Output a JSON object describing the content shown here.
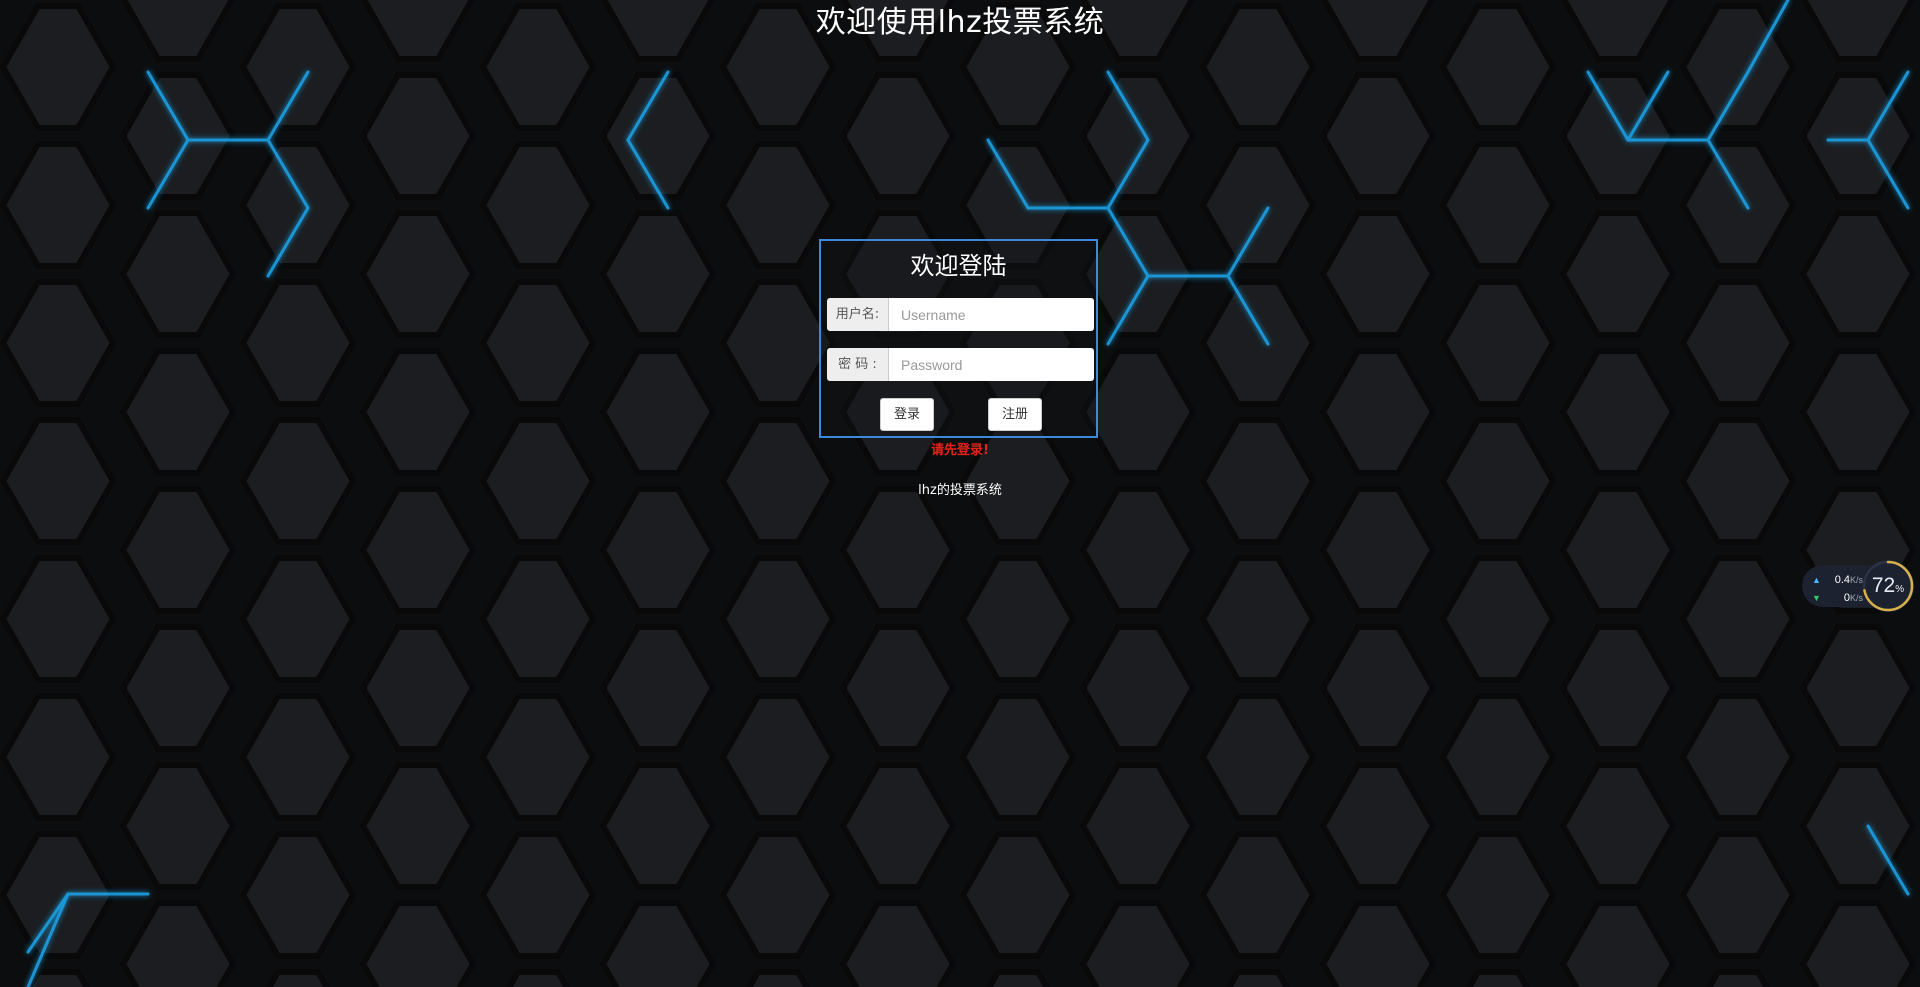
{
  "page": {
    "title": "欢迎使用lhz投票系统"
  },
  "login_form": {
    "heading": "欢迎登陆",
    "username_label": "用户名:",
    "username_placeholder": "Username",
    "password_label": "密 码 :",
    "password_placeholder": "Password",
    "login_button": "登录",
    "register_button": "注册"
  },
  "alert": {
    "message": "请先登录!",
    "color": "#e8221b"
  },
  "footer": {
    "text": "lhz的投票系统"
  },
  "network_widget": {
    "upload_value": "0.4",
    "upload_unit": "K/s",
    "download_value": "0",
    "download_unit": "K/s",
    "usage_value": "72",
    "usage_unit": "%",
    "usage_fraction": 0.72
  },
  "colors": {
    "background": "#141517",
    "hex_glow": "#1aa3e8",
    "panel_border": "#3d88d8"
  }
}
